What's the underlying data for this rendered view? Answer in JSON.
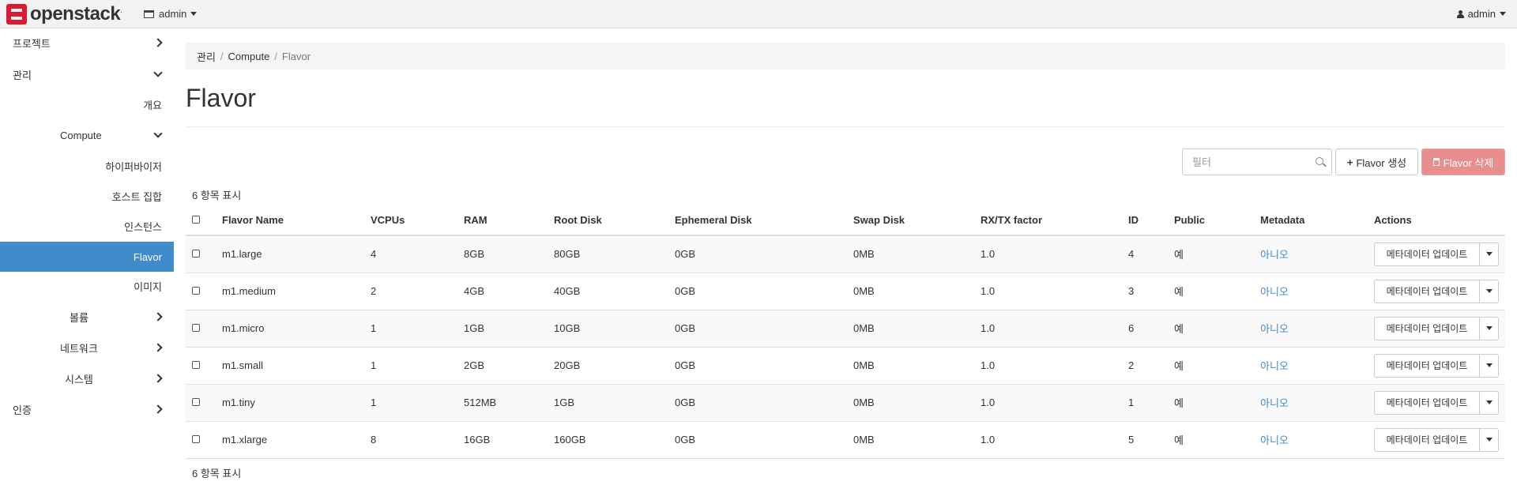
{
  "topbar": {
    "logo_text": "openstack",
    "logo_tm": ".",
    "project_label": "admin",
    "user_label": "admin"
  },
  "sidebar": {
    "items": [
      {
        "label": "프로젝트"
      },
      {
        "label": "관리"
      },
      {
        "label": "개요"
      },
      {
        "label": "Compute"
      },
      {
        "label": "하이퍼바이저"
      },
      {
        "label": "호스트 집합"
      },
      {
        "label": "인스턴스"
      },
      {
        "label": "Flavor"
      },
      {
        "label": "이미지"
      },
      {
        "label": "볼륨"
      },
      {
        "label": "네트워크"
      },
      {
        "label": "시스템"
      },
      {
        "label": "인증"
      }
    ]
  },
  "breadcrumb": [
    "관리",
    "Compute",
    "Flavor"
  ],
  "page_title": "Flavor",
  "toolbar": {
    "filter_placeholder": "필터",
    "create_label": "Flavor 생성",
    "delete_label": "Flavor 삭제"
  },
  "count_label": "6 항목 표시",
  "table": {
    "headers": [
      "Flavor Name",
      "VCPUs",
      "RAM",
      "Root Disk",
      "Ephemeral Disk",
      "Swap Disk",
      "RX/TX factor",
      "ID",
      "Public",
      "Metadata",
      "Actions"
    ],
    "rows": [
      {
        "name": "m1.large",
        "vcpus": "4",
        "ram": "8GB",
        "root": "80GB",
        "eph": "0GB",
        "swap": "0MB",
        "rxtx": "1.0",
        "id": "4",
        "public": "예",
        "metadata": "아니오",
        "action": "메타데이터 업데이트"
      },
      {
        "name": "m1.medium",
        "vcpus": "2",
        "ram": "4GB",
        "root": "40GB",
        "eph": "0GB",
        "swap": "0MB",
        "rxtx": "1.0",
        "id": "3",
        "public": "예",
        "metadata": "아니오",
        "action": "메타데이터 업데이트"
      },
      {
        "name": "m1.micro",
        "vcpus": "1",
        "ram": "1GB",
        "root": "10GB",
        "eph": "0GB",
        "swap": "0MB",
        "rxtx": "1.0",
        "id": "6",
        "public": "예",
        "metadata": "아니오",
        "action": "메타데이터 업데이트"
      },
      {
        "name": "m1.small",
        "vcpus": "1",
        "ram": "2GB",
        "root": "20GB",
        "eph": "0GB",
        "swap": "0MB",
        "rxtx": "1.0",
        "id": "2",
        "public": "예",
        "metadata": "아니오",
        "action": "메타데이터 업데이트"
      },
      {
        "name": "m1.tiny",
        "vcpus": "1",
        "ram": "512MB",
        "root": "1GB",
        "eph": "0GB",
        "swap": "0MB",
        "rxtx": "1.0",
        "id": "1",
        "public": "예",
        "metadata": "아니오",
        "action": "메타데이터 업데이트"
      },
      {
        "name": "m1.xlarge",
        "vcpus": "8",
        "ram": "16GB",
        "root": "160GB",
        "eph": "0GB",
        "swap": "0MB",
        "rxtx": "1.0",
        "id": "5",
        "public": "예",
        "metadata": "아니오",
        "action": "메타데이터 업데이트"
      }
    ]
  },
  "colors": {
    "accent": "#428bca",
    "danger": "#e88e8e",
    "logo": "#da1a32"
  }
}
